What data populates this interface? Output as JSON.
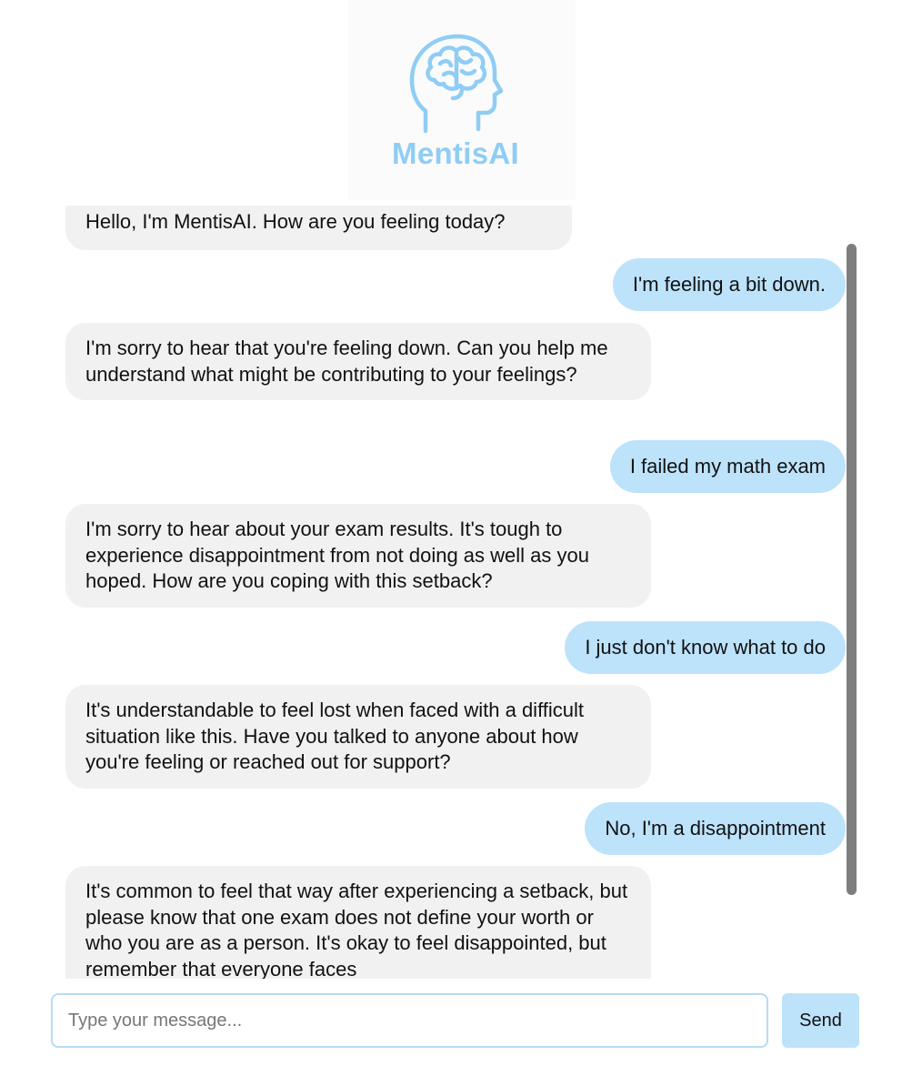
{
  "header": {
    "app_name": "MentisAI",
    "logo_icon": "head-brain-icon",
    "brand_color": "#8fcdf6"
  },
  "messages": [
    {
      "role": "bot",
      "text": "Hello, I'm MentisAI. How are you feeling today?"
    },
    {
      "role": "user",
      "text": "I'm feeling a bit down."
    },
    {
      "role": "bot",
      "text": "I'm sorry to hear that you're feeling down. Can you help me understand what might be contributing to your feelings?"
    },
    {
      "role": "user",
      "text": "I failed my math exam"
    },
    {
      "role": "bot",
      "text": "I'm sorry to hear about your exam results. It's tough to experience disappointment from not doing as well as you hoped. How are you coping with this setback?"
    },
    {
      "role": "user",
      "text": "I just don't know what to do"
    },
    {
      "role": "bot",
      "text": "It's understandable to feel lost when faced with a difficult situation like this. Have you talked to anyone about how you're feeling or reached out for support?"
    },
    {
      "role": "user",
      "text": "No, I'm a disappointment"
    },
    {
      "role": "bot",
      "text": "It's common to feel that way after experiencing a setback, but please know that one exam does not define your worth or who you are as a person. It's okay to feel disappointed, but remember that everyone faces"
    }
  ],
  "colors": {
    "bot_bubble": "#f1f1f1",
    "user_bubble": "#bde3fb",
    "input_border": "#b5dcf4"
  },
  "composer": {
    "placeholder": "Type your message...",
    "value": "",
    "send_label": "Send"
  }
}
